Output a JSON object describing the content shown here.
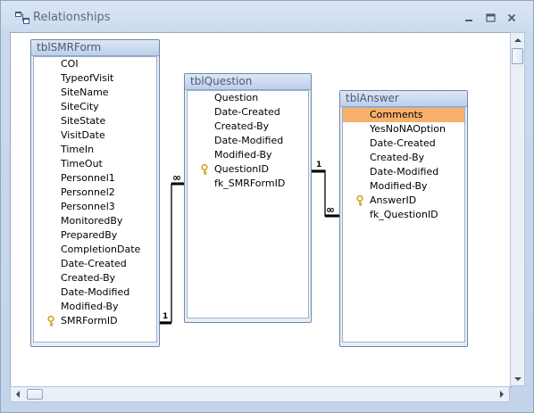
{
  "window": {
    "title": "Relationships",
    "icon": "relationships-icon",
    "controls": [
      "minimize-icon",
      "maximize-icon",
      "close-icon"
    ]
  },
  "tables": [
    {
      "name": "tblSMRForm",
      "fields": [
        {
          "name": "COI",
          "key": false
        },
        {
          "name": "TypeofVisit",
          "key": false
        },
        {
          "name": "SiteName",
          "key": false
        },
        {
          "name": "SiteCity",
          "key": false
        },
        {
          "name": "SiteState",
          "key": false
        },
        {
          "name": "VisitDate",
          "key": false
        },
        {
          "name": "TimeIn",
          "key": false
        },
        {
          "name": "TimeOut",
          "key": false
        },
        {
          "name": "Personnel1",
          "key": false
        },
        {
          "name": "Personnel2",
          "key": false
        },
        {
          "name": "Personnel3",
          "key": false
        },
        {
          "name": "MonitoredBy",
          "key": false
        },
        {
          "name": "PreparedBy",
          "key": false
        },
        {
          "name": "CompletionDate",
          "key": false
        },
        {
          "name": "Date-Created",
          "key": false
        },
        {
          "name": "Created-By",
          "key": false
        },
        {
          "name": "Date-Modified",
          "key": false
        },
        {
          "name": "Modified-By",
          "key": false
        },
        {
          "name": "SMRFormID",
          "key": true
        }
      ]
    },
    {
      "name": "tblQuestion",
      "fields": [
        {
          "name": "Question",
          "key": false
        },
        {
          "name": "Date-Created",
          "key": false
        },
        {
          "name": "Created-By",
          "key": false
        },
        {
          "name": "Date-Modified",
          "key": false
        },
        {
          "name": "Modified-By",
          "key": false
        },
        {
          "name": "QuestionID",
          "key": true
        },
        {
          "name": "fk_SMRFormID",
          "key": false
        }
      ]
    },
    {
      "name": "tblAnswer",
      "fields": [
        {
          "name": "Comments",
          "key": false,
          "selected": true
        },
        {
          "name": "YesNoNAOption",
          "key": false
        },
        {
          "name": "Date-Created",
          "key": false
        },
        {
          "name": "Created-By",
          "key": false
        },
        {
          "name": "Date-Modified",
          "key": false
        },
        {
          "name": "Modified-By",
          "key": false
        },
        {
          "name": "AnswerID",
          "key": true
        },
        {
          "name": "fk_QuestionID",
          "key": false
        }
      ]
    }
  ],
  "relationships": [
    {
      "one_label": "1",
      "many_label": "∞",
      "from": "tblSMRForm.SMRFormID",
      "to": "tblQuestion.fk_SMRFormID"
    },
    {
      "one_label": "1",
      "many_label": "∞",
      "from": "tblQuestion.QuestionID",
      "to": "tblAnswer.fk_QuestionID"
    }
  ],
  "colors": {
    "selected_row": "#f7b06a",
    "window_frame": "#c5d6ec",
    "key_icon": "#c9a227"
  }
}
